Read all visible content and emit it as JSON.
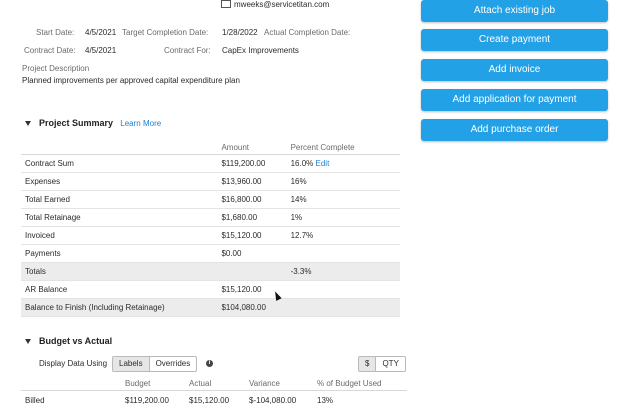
{
  "contact": {
    "email": "mweeks@servicetitan.com"
  },
  "details": {
    "start_date_label": "Start Date:",
    "start_date": "4/5/2021",
    "target_label": "Target Completion Date:",
    "target": "1/28/2022",
    "actual_label": "Actual Completion Date:",
    "contract_date_label": "Contract Date:",
    "contract_date": "4/5/2021",
    "contract_for_label": "Contract For:",
    "contract_for": "CapEx Improvements",
    "description_label": "Project Description",
    "description": "Planned improvements per approved capital expenditure plan"
  },
  "actions": [
    "Attach existing job",
    "Create payment",
    "Add invoice",
    "Add application for payment",
    "Add purchase order"
  ],
  "project_summary": {
    "title": "Project Summary",
    "learn_more": "Learn More",
    "columns": [
      "",
      "Amount",
      "Percent Complete"
    ],
    "edit_label": "Edit",
    "rows": [
      {
        "label": "Contract Sum",
        "amount": "$119,200.00",
        "pct": "16.0%"
      },
      {
        "label": "Expenses",
        "amount": "$13,960.00",
        "pct": "16%"
      },
      {
        "label": "Total Earned",
        "amount": "$16,800.00",
        "pct": "14%"
      },
      {
        "label": "Total Retainage",
        "amount": "$1,680.00",
        "pct": "1%"
      },
      {
        "label": "Invoiced",
        "amount": "$15,120.00",
        "pct": "12.7%"
      },
      {
        "label": "Payments",
        "amount": "$0.00",
        "pct": ""
      },
      {
        "label": "Totals",
        "amount": "",
        "pct": "-3.3%"
      },
      {
        "label": "AR Balance",
        "amount": "$15,120.00",
        "pct": ""
      },
      {
        "label": "Balance to Finish (Including Retainage)",
        "amount": "$104,080.00",
        "pct": ""
      }
    ]
  },
  "budget_vs_actual": {
    "title": "Budget vs Actual",
    "display_label": "Display Data Using",
    "toggle": [
      "Labels",
      "Overrides"
    ],
    "unit_toggle": [
      "$",
      "QTY"
    ],
    "columns": [
      "Budget",
      "Actual",
      "Variance",
      "% of Budget Used"
    ],
    "rows": [
      {
        "label": "Billed",
        "budget": "$119,200.00",
        "actual": "$15,120.00",
        "variance": "$-104,080.00",
        "pct": "13%"
      }
    ]
  }
}
